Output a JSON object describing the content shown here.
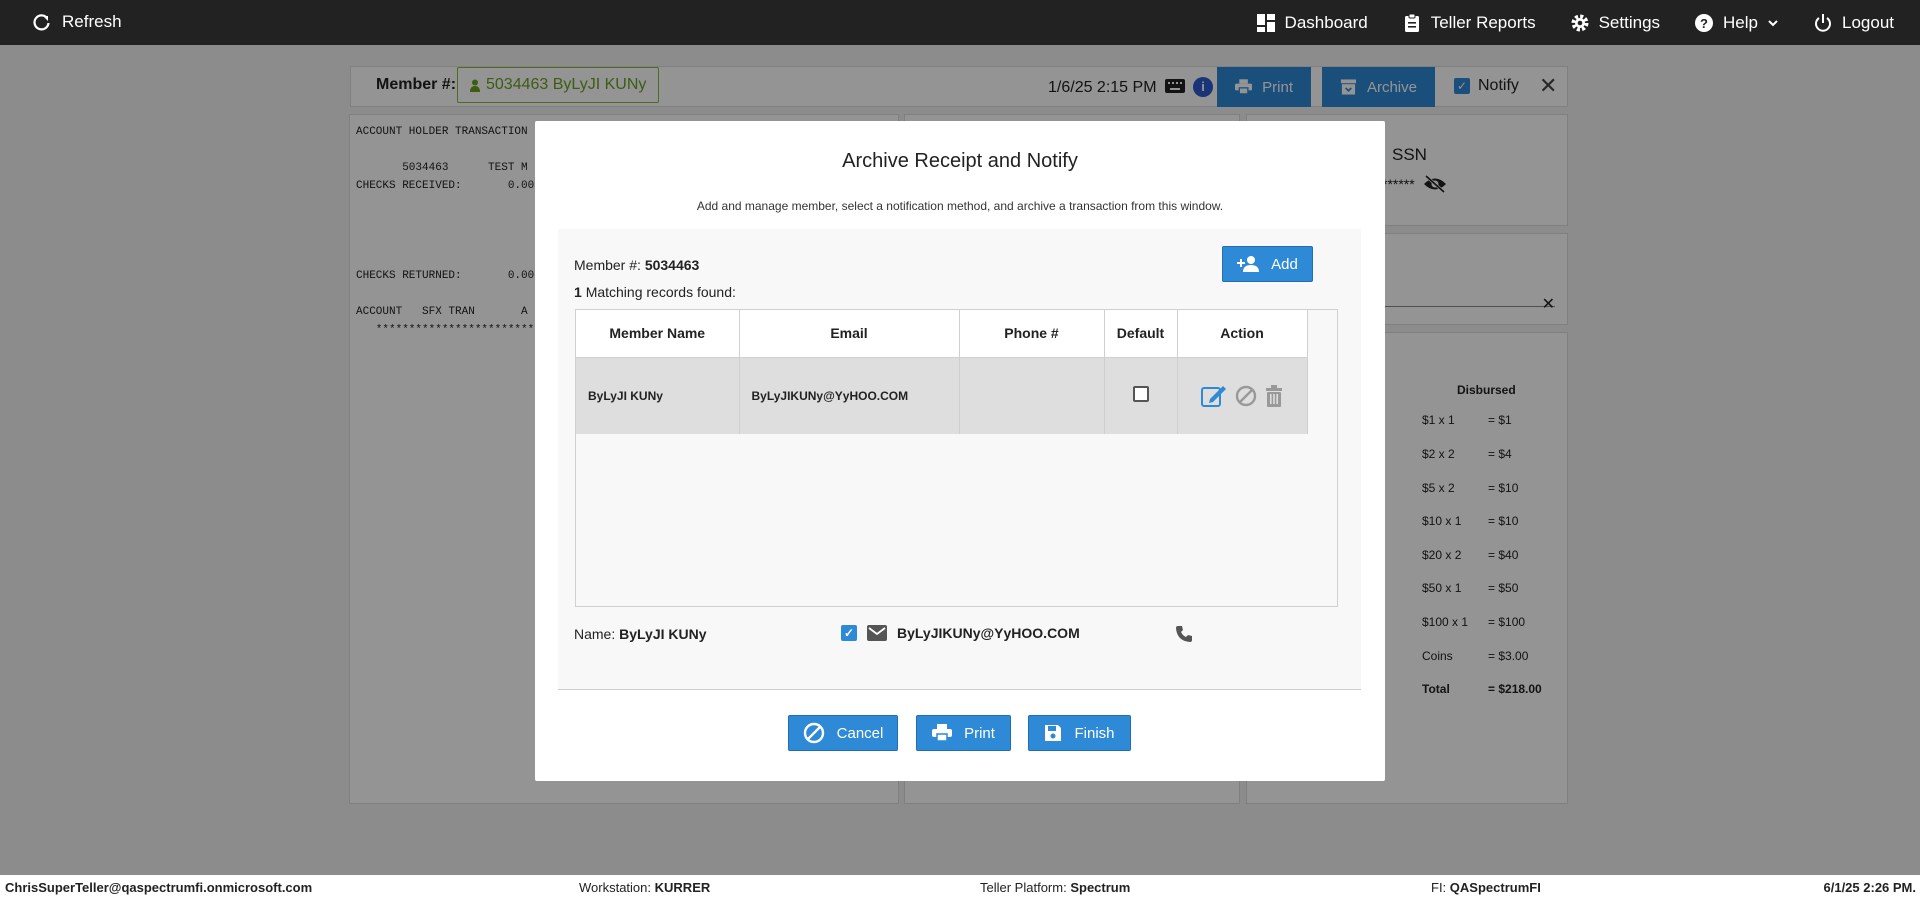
{
  "topbar": {
    "refresh_label": "Refresh",
    "nav": [
      {
        "label": "Dashboard",
        "icon": "dashboard-icon"
      },
      {
        "label": "Teller Reports",
        "icon": "clipboard-icon"
      },
      {
        "label": "Settings",
        "icon": "gear-icon"
      },
      {
        "label": "Help",
        "icon": "help-icon"
      },
      {
        "label": "Logout",
        "icon": "power-icon"
      }
    ]
  },
  "header": {
    "member_label": "Member #:",
    "member_chip": "5034463 ByLyJI KUNy",
    "datetime": "1/6/25 2:15 PM",
    "info_glyph": "i",
    "print_label": "Print",
    "archive_label": "Archive",
    "notify_label": "Notify",
    "notify_checked": true
  },
  "receipt_text": "ACCOUNT HOLDER TRANSACTION\n\n       5034463      TEST M\nCHECKS RECEIVED:       0.00\n\n\n\n\nCHECKS RETURNED:       0.00\n\nACCOUNT   SFX TRAN       A\n   **************************",
  "right_panel": {
    "ssn_label": "SSN",
    "ssn_masked": "******",
    "clear_glyph": "✕",
    "cash": {
      "disbursed_header": "Disbursed",
      "rows": [
        {
          "qty": "$1 x 1",
          "amt": "= $1"
        },
        {
          "qty": "$2 x 2",
          "amt": "= $4"
        },
        {
          "qty": "$5 x 2",
          "amt": "= $10"
        },
        {
          "qty": "$10 x 1",
          "amt": "= $10"
        },
        {
          "qty": "$20 x 2",
          "amt": "= $40"
        },
        {
          "qty": "$50 x 1",
          "amt": "= $50"
        },
        {
          "qty": "$100 x 1",
          "amt": "= $100"
        },
        {
          "qty": "Coins",
          "amt": "= $3.00"
        },
        {
          "qty": "Total",
          "amt": "= $218.00"
        }
      ]
    }
  },
  "modal": {
    "title": "Archive Receipt and Notify",
    "subtitle": "Add and manage member, select a notification method, and archive a transaction from this window.",
    "member_label": "Member #:",
    "member_number": "5034463",
    "match_count": "1",
    "match_text": "Matching records found:",
    "add_label": "Add",
    "columns": [
      "Member Name",
      "Email",
      "Phone #",
      "Default",
      "Action"
    ],
    "rows": [
      {
        "name": "ByLyJI KUNy",
        "email": "ByLyJIKUNy@YyHOO.COM",
        "phone": "",
        "default": false
      }
    ],
    "name_label": "Name:",
    "name_value": "ByLyJI KUNy",
    "email_checked": true,
    "email_value": "ByLyJIKUNy@YyHOO.COM",
    "cancel_label": "Cancel",
    "print_label": "Print",
    "finish_label": "Finish"
  },
  "statusbar": {
    "user": "ChrisSuperTeller@qaspectrumfi.onmicrosoft.com",
    "workstation_label": "Workstation:",
    "workstation": "KURRER",
    "platform_label": "Teller Platform:",
    "platform": "Spectrum",
    "fi_label": "FI:",
    "fi": "QASpectrumFI",
    "datetime": "6/1/25 2:26 PM."
  },
  "colors": {
    "accent": "#2e89d6",
    "topbar": "#222222",
    "member_chip": "#6aa120"
  }
}
